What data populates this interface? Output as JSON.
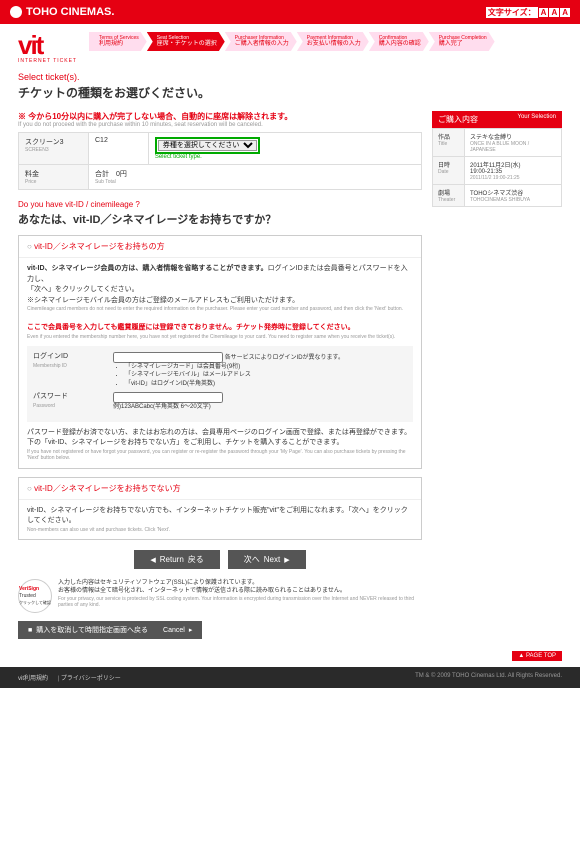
{
  "header": {
    "brand": "TOHO CINEMAS.",
    "fontsize_label": "文字サイズ：",
    "sizes": [
      "A",
      "A",
      "A"
    ]
  },
  "logo": {
    "main": "vit",
    "sub": "INTERNET TICKET"
  },
  "steps": [
    {
      "en": "Terms of Services",
      "jp": "利用規約"
    },
    {
      "en": "Seat Selection",
      "jp": "座席・チケットの選択"
    },
    {
      "en": "Purchaser Information",
      "jp": "ご購入者情報の入力"
    },
    {
      "en": "Payment Information",
      "jp": "お支払い情報の入力"
    },
    {
      "en": "Confirmation",
      "jp": "購入内容の確認"
    },
    {
      "en": "Purchase Completion",
      "jp": "購入完了"
    }
  ],
  "title": {
    "en": "Select ticket(s).",
    "jp": "チケットの種類をお選びください。"
  },
  "warn": {
    "jp": "※ 今から10分以内に購入が完了しない場合、自動的に座席は解除されます。",
    "en": "If you do not proceed with the purchase within 10 minutes, seat reservation will be canceled."
  },
  "screen": {
    "label": "スクリーン3",
    "label_en": "SCREEN3",
    "seat": "C12",
    "select_placeholder": "券種を選択してください",
    "hint": "Select ticket type."
  },
  "price": {
    "label": "料金",
    "label_en": "Price",
    "sub": "合計",
    "sub_en": "Sub Total",
    "val": "0円"
  },
  "sec2": {
    "en": "Do you have vit-ID / cinemileage ?",
    "jp": "あなたは、vit-ID／シネマイレージをお持ちですか？"
  },
  "box1": {
    "title": "vit-ID／シネマイレージをお持ちの方",
    "l1a": "vit-ID、シネマイレージ会員の方は、購入者情報を省略することができます。",
    "l1b": "ログインIDまたは会員番号とパスワードを入力し、",
    "l2": "「次へ」をクリックしてください。",
    "l3": "※シネマイレージモバイル会員の方はご登録のメールアドレスもご利用いただけます。",
    "l3en": "Cinemileage card members do not need to enter the required information on the purchaser. Please enter your card number and password, and then click the 'Next' button.",
    "w1": "ここで会員番号を入力しても鑑賞履歴には登録できておりません。チケット発券時に登録してください。",
    "w1en": "Even if you entered the membership number here, you have not yet registered the Cinemileage to your card. You need to register same when you receive the ticket(s).",
    "login": {
      "label": "ログインID",
      "label_en": "Membership ID",
      "hint": "各サービスによりログインIDが異なります。",
      "opts": [
        "「シネマイレージカード」は会員番号(9桁)",
        "「シネマイレージモバイル」はメールアドレス",
        "「vit-ID」はログインID(半角英数)"
      ]
    },
    "pass": {
      "label": "パスワード",
      "label_en": "Password",
      "hint": "例)123ABCabc(半角英数 6〜20文字)"
    },
    "foot": "パスワード登録がお済でない方、またはお忘れの方は、会員専用ページのログイン画面で登録、または再登録ができます。",
    "foot2": "下の「vit-ID、シネマイレージをお持ちでない方」をご利用し、チケットを購入することができます。",
    "footen": "If you have not registered or have forgot your password, you can register or re-register the password through your 'My Page'. You can also purchase tickets by pressing the 'Next' button below."
  },
  "box2": {
    "title": "vit-ID／シネマイレージをお持ちでない方",
    "body": "vit-ID、シネマイレージをお持ちでない方でも、インターネットチケット販売\"vit\"をご利用になれます。「次へ」をクリックしてください。",
    "en": "Non-members can also use vit and purchase tickets. Click 'Next'."
  },
  "btns": {
    "back": "Return",
    "back_jp": "戻る",
    "next": "次へ",
    "next_en": "Next"
  },
  "trust": {
    "badge": "VeriSign Trusted",
    "badge_sub": "クリックして確認",
    "l1": "入力した内容はセキュリティソフトウェア(SSL)により保護されています。",
    "l2": "お客様の情報は全て暗号化され、インターネットで情報が送信される際に読み取られることはありません。",
    "en": "For your privacy, our service is protected by SSL coding system. Your information is encrypted during transmission over the Internet and NEVER released to third parties of any kind."
  },
  "cancel": {
    "jp": "購入を取消して時間指定画面へ戻る",
    "en": "Cancel"
  },
  "side": {
    "title": "ご購入内容",
    "title_en": "Your Selection",
    "rows": [
      {
        "l": "作品",
        "l_en": "Title",
        "v": "ステキな金縛り",
        "v2": "ONCE IN A BLUE MOON / JAPANESE"
      },
      {
        "l": "日時",
        "l_en": "Date",
        "v": "2011年11月2日(水)",
        "v2": "19:00-21:35",
        "v3": "2011/11/2  19:00-21:25"
      },
      {
        "l": "劇場",
        "l_en": "Theater",
        "v": "TOHOシネマズ渋谷",
        "v2": "TOHOCINEMAS SHIBUYA"
      }
    ]
  },
  "pagetop": "▲ PAGE TOP",
  "footer": {
    "links": [
      "vit利用規約",
      "プライバシーポリシー"
    ],
    "copy": "TM & © 2009 TOHO Cinemas Ltd. All Rights Reserved."
  }
}
